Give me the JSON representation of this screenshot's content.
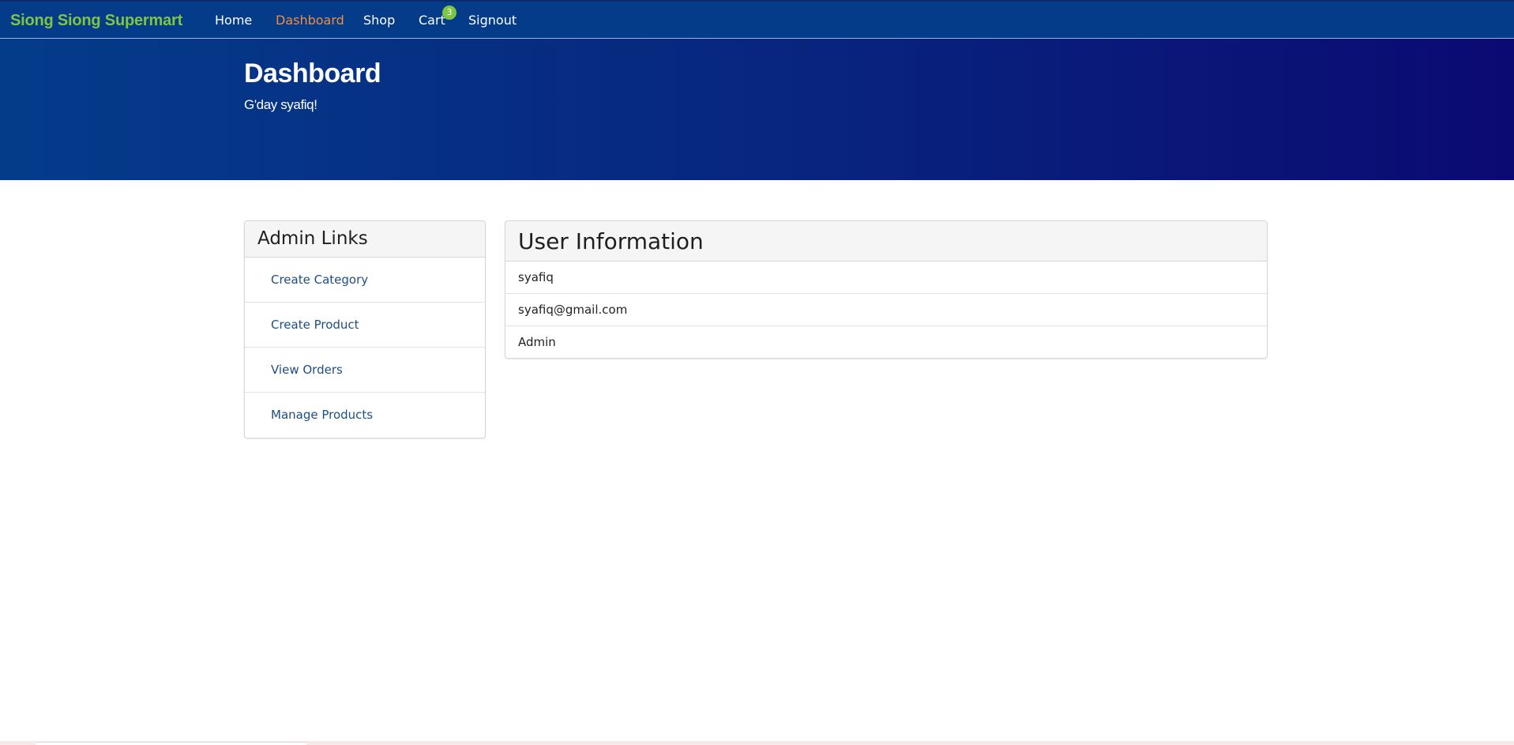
{
  "navbar": {
    "brand": "Siong Siong Supermart",
    "links": [
      {
        "label": "Home"
      },
      {
        "label": "Dashboard",
        "active": true
      },
      {
        "label": "Shop"
      },
      {
        "label": "Cart"
      },
      {
        "label": "Signout"
      }
    ],
    "cart_count": "3"
  },
  "header": {
    "title": "Dashboard",
    "greeting": "G'day syafiq!"
  },
  "admin_links": {
    "title": "Admin Links",
    "items": [
      {
        "label": "Create Category"
      },
      {
        "label": "Create Product"
      },
      {
        "label": "View Orders"
      },
      {
        "label": "Manage Products"
      }
    ]
  },
  "user_info": {
    "title": "User Information",
    "name": "syafiq",
    "email": "syafiq@gmail.com",
    "role": "Admin"
  },
  "colors": {
    "navbar": "#043c8a",
    "brand": "#7ec544",
    "active_link": "#f28c3f",
    "gradient_start": "#043c8a",
    "gradient_end": "#0b0a72",
    "link_text": "#1c4e86"
  }
}
